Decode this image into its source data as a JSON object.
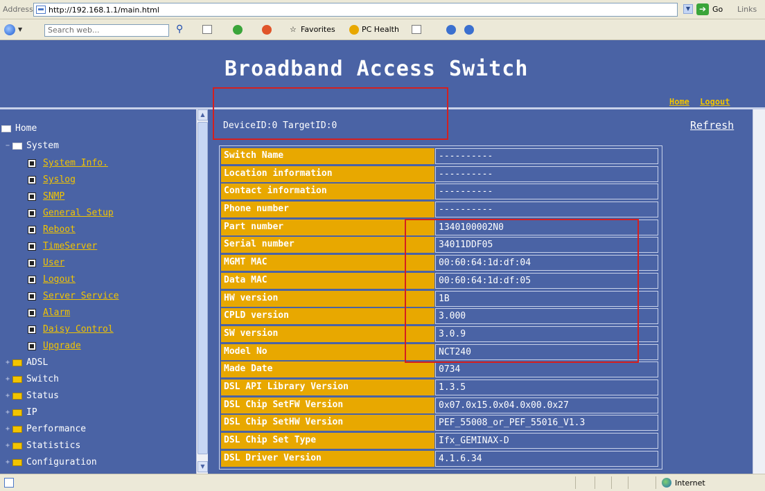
{
  "browser": {
    "address_label": "Address",
    "url": "http://192.168.1.1/main.html",
    "go_label": "Go",
    "links_label": "Links",
    "search_placeholder": "Search web...",
    "favorites_label": "Favorites",
    "pc_health_label": "PC Health",
    "status_zone": "Internet"
  },
  "header": {
    "title": "Broadband Access Switch",
    "links": [
      "Home",
      "Logout"
    ]
  },
  "sidebar": {
    "home": "Home",
    "system": "System",
    "system_items": [
      "System Info.",
      "Syslog",
      "SNMP",
      "General Setup",
      "Reboot",
      "TimeServer",
      "User",
      "Logout",
      "Server Service",
      "Alarm",
      "Daisy Control",
      "Upgrade"
    ],
    "folders": [
      "ADSL",
      "Switch",
      "Status",
      "IP",
      "Performance",
      "Statistics",
      "Configuration"
    ]
  },
  "main": {
    "device_line": "DeviceID:0 TargetID:0",
    "refresh_label": "Refresh",
    "rows": [
      {
        "key": "Switch Name",
        "value": "----------"
      },
      {
        "key": "Location information",
        "value": "----------"
      },
      {
        "key": "Contact information",
        "value": "----------"
      },
      {
        "key": "Phone number",
        "value": "----------"
      },
      {
        "key": "Part number",
        "value": "1340100002N0"
      },
      {
        "key": "Serial number",
        "value": "34011DDF05"
      },
      {
        "key": "MGMT MAC",
        "value": "00:60:64:1d:df:04"
      },
      {
        "key": "Data MAC",
        "value": "00:60:64:1d:df:05"
      },
      {
        "key": "HW version",
        "value": "1B"
      },
      {
        "key": "CPLD version",
        "value": "3.000"
      },
      {
        "key": "SW version",
        "value": "3.0.9"
      },
      {
        "key": "Model No",
        "value": "NCT240"
      },
      {
        "key": "Made Date",
        "value": "0734"
      },
      {
        "key": "DSL API Library Version",
        "value": "1.3.5"
      },
      {
        "key": "DSL Chip SetFW Version",
        "value": "0x07.0x15.0x04.0x00.0x27"
      },
      {
        "key": "DSL Chip SetHW Version",
        "value": "PEF_55008_or_PEF_55016_V1.3"
      },
      {
        "key": "DSL Chip Set Type",
        "value": "Ifx_GEMINAX-D"
      },
      {
        "key": "DSL Driver Version",
        "value": "4.1.6.34"
      }
    ]
  },
  "colors": {
    "page_bg": "#4a63a5",
    "key_cell": "#e8a800",
    "link_yellow": "#f2c400",
    "highlight": "#d41f1f"
  }
}
